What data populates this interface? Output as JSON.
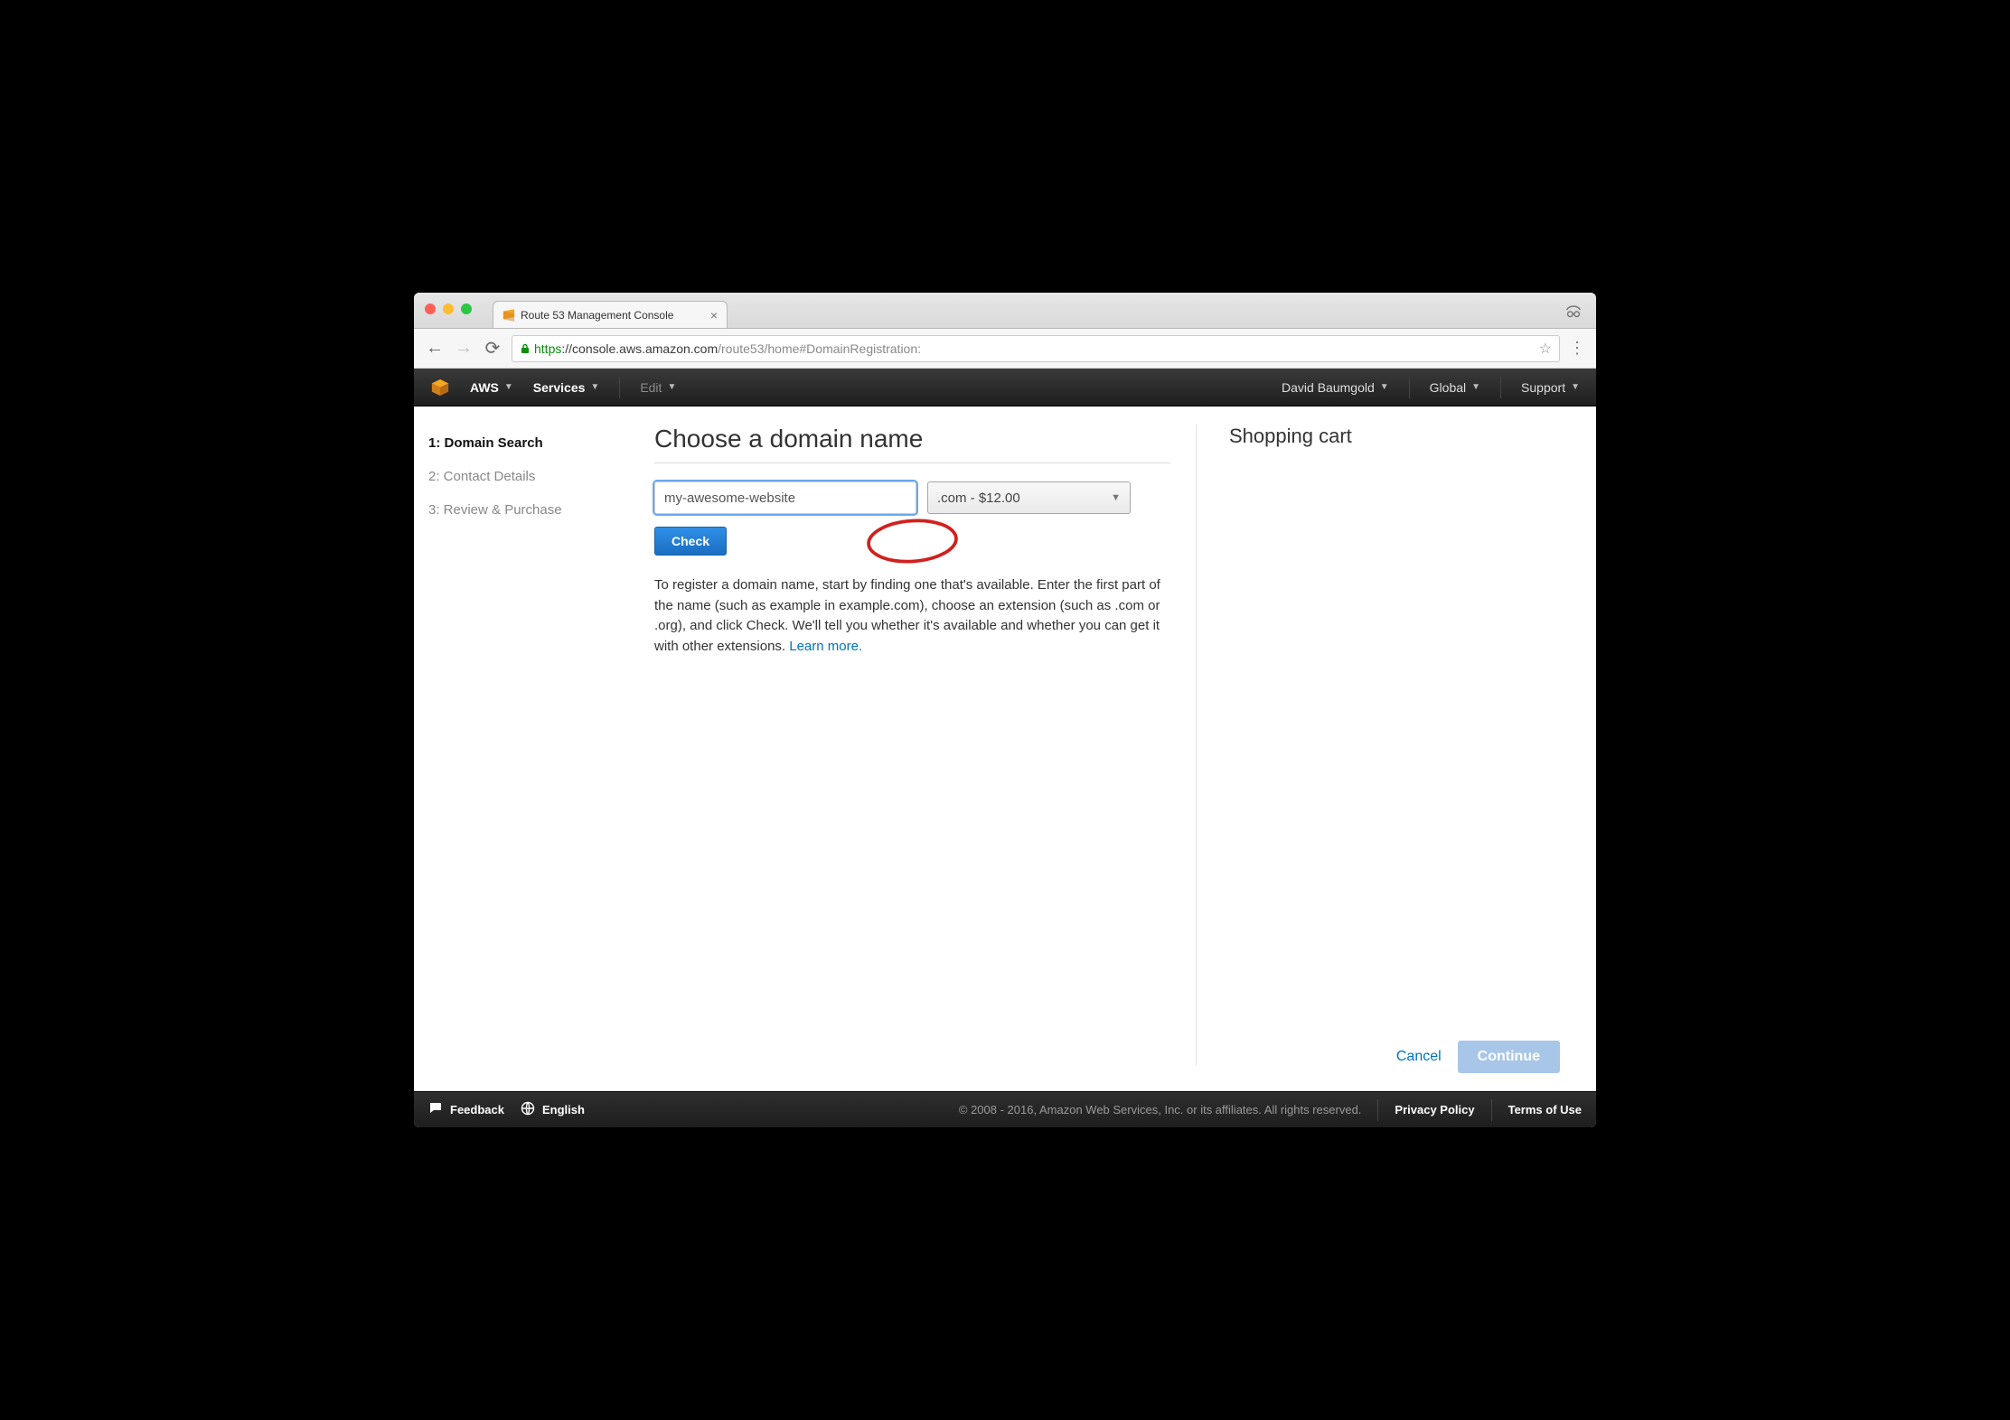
{
  "browser": {
    "tab_title": "Route 53 Management Console",
    "url_scheme": "https",
    "url_host": "://console.aws.amazon.com",
    "url_path": "/route53/home#DomainRegistration:"
  },
  "header": {
    "aws_label": "AWS",
    "services_label": "Services",
    "edit_label": "Edit",
    "user_name": "David Baumgold",
    "region_label": "Global",
    "support_label": "Support"
  },
  "wizard": {
    "steps": [
      {
        "label": "1: Domain Search",
        "active": true
      },
      {
        "label": "2: Contact Details",
        "active": false
      },
      {
        "label": "3: Review & Purchase",
        "active": false
      }
    ]
  },
  "main": {
    "title": "Choose a domain name",
    "domain_value": "my-awesome-website",
    "tld_selected": ".com - $12.00",
    "check_label": "Check",
    "help_text": "To register a domain name, start by finding one that's available. Enter the first part of the name (such as example in example.com), choose an extension (such as .com or .org), and click Check. We'll tell you whether it's available and whether you can get it with other extensions.  ",
    "learn_more": "Learn more.",
    "cancel_label": "Cancel",
    "continue_label": "Continue"
  },
  "cart": {
    "title": "Shopping cart"
  },
  "footer": {
    "feedback": "Feedback",
    "language": "English",
    "copyright": "© 2008 - 2016, Amazon Web Services, Inc. or its affiliates. All rights reserved.",
    "privacy": "Privacy Policy",
    "terms": "Terms of Use"
  }
}
